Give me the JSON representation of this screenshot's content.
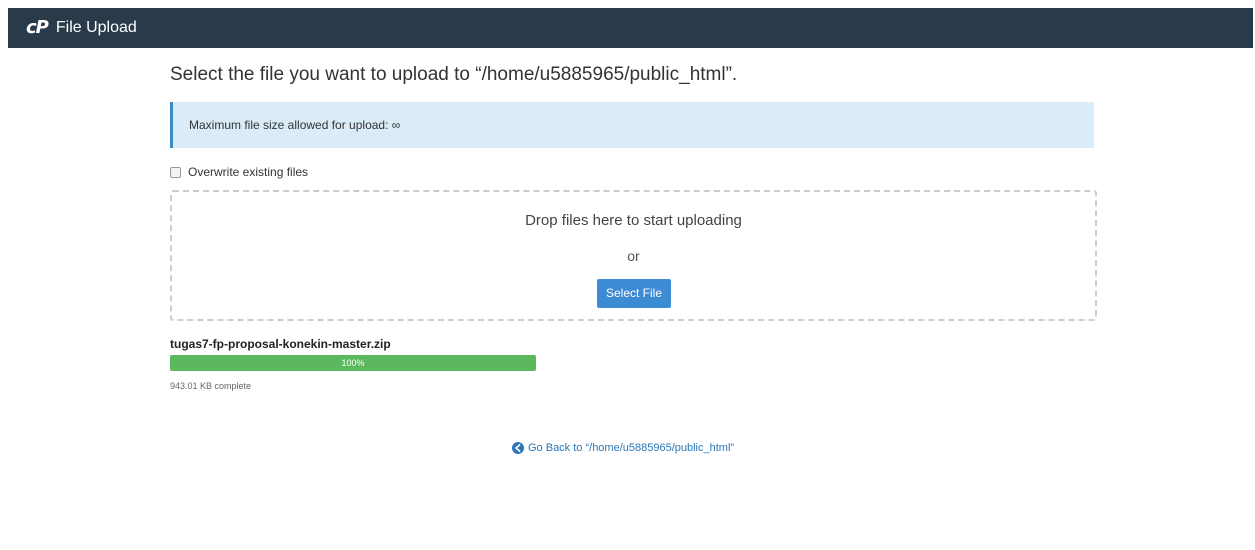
{
  "header": {
    "logo_text": "cP",
    "title": "File Upload",
    "bar_color": "#293a4a"
  },
  "main": {
    "heading": "Select the file you want to upload to “/home/u5885965/public_html”.",
    "info_text": "Maximum file size allowed for upload: ∞",
    "overwrite_label": "Overwrite existing files",
    "overwrite_checked": false
  },
  "dropzone": {
    "text": "Drop files here to start uploading",
    "or_text": "or",
    "select_button_label": "Select File"
  },
  "upload": {
    "file_name": "tugas7-fp-proposal-konekin-master.zip",
    "progress_percent": 100,
    "progress_label": "100%",
    "status_text": "943.01 KB complete",
    "progress_color": "#5cb85c"
  },
  "footer": {
    "back_link_text": "Go Back to “/home/u5885965/public_html”",
    "back_icon": "circle-arrow-left-icon"
  }
}
